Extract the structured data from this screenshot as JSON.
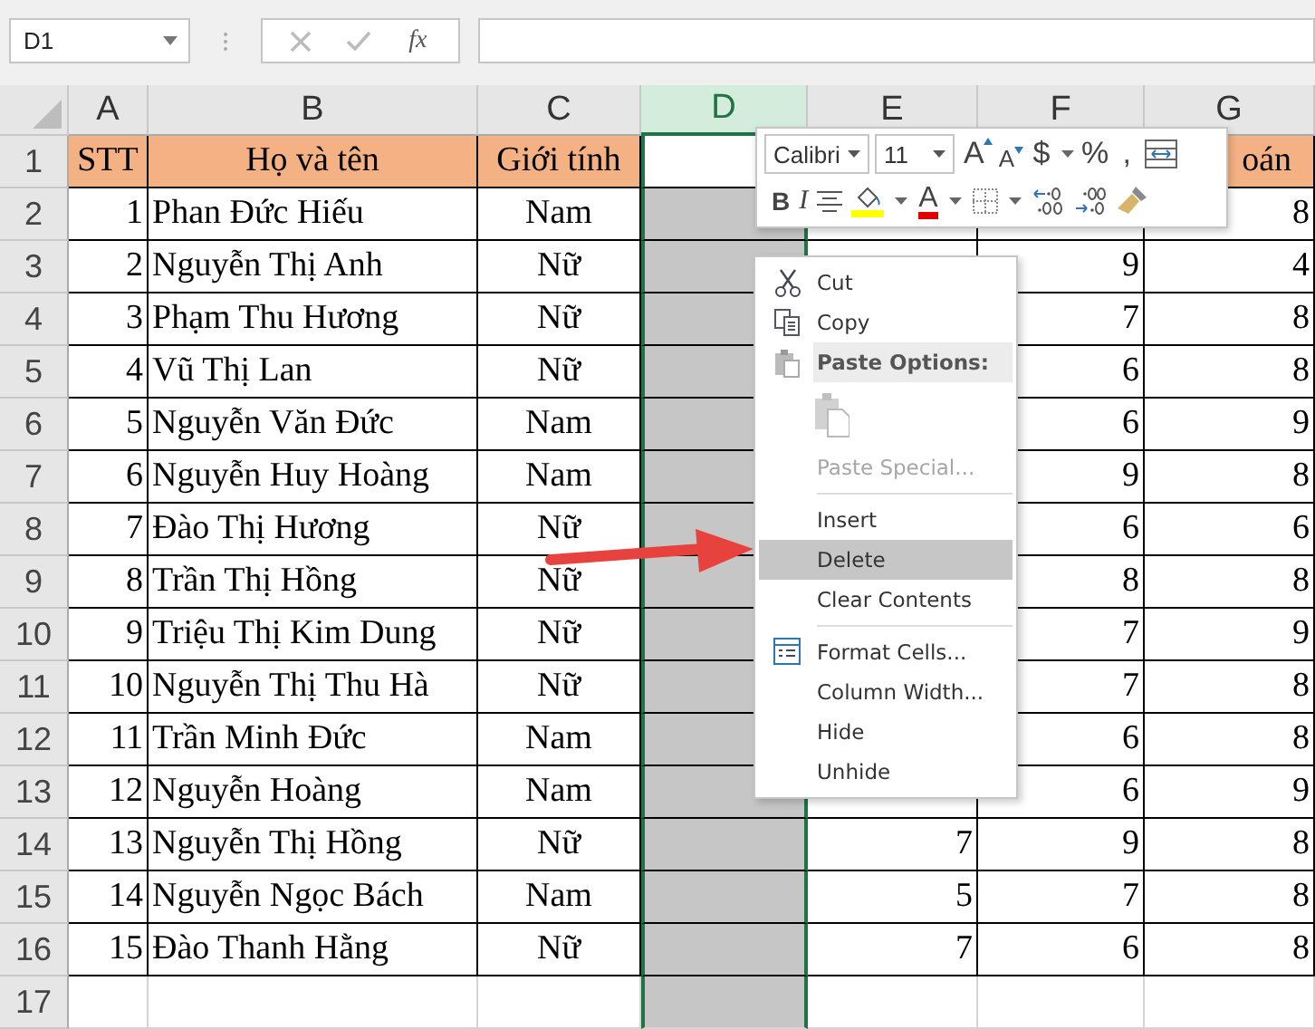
{
  "formula_bar": {
    "name_box": "D1",
    "function_label": "fx"
  },
  "columns": [
    {
      "label": "A",
      "selected": false
    },
    {
      "label": "B",
      "selected": false
    },
    {
      "label": "C",
      "selected": false
    },
    {
      "label": "D",
      "selected": true
    },
    {
      "label": "E",
      "selected": false
    },
    {
      "label": "F",
      "selected": false
    },
    {
      "label": "G",
      "selected": false
    }
  ],
  "rows": [
    {
      "number": "1",
      "kind": "header",
      "cells": [
        "STT",
        "Họ và tên",
        "Giới tính",
        "",
        null,
        null,
        "oán"
      ]
    },
    {
      "number": "2",
      "kind": "data",
      "cells": [
        "1",
        "Phan Đức Hiếu",
        "Nam",
        "",
        "",
        "",
        "8"
      ]
    },
    {
      "number": "3",
      "kind": "data",
      "cells": [
        "2",
        "Nguyễn Thị Anh",
        "Nữ",
        "",
        "",
        "9",
        "4"
      ]
    },
    {
      "number": "4",
      "kind": "data",
      "cells": [
        "3",
        "Phạm Thu Hương",
        "Nữ",
        "",
        null,
        "7",
        "8"
      ]
    },
    {
      "number": "5",
      "kind": "data",
      "cells": [
        "4",
        "Vũ Thị Lan",
        "Nữ",
        "",
        null,
        "6",
        "8"
      ]
    },
    {
      "number": "6",
      "kind": "data",
      "cells": [
        "5",
        "Nguyễn Văn Đức",
        "Nam",
        "",
        null,
        "6",
        "9"
      ]
    },
    {
      "number": "7",
      "kind": "data",
      "cells": [
        "6",
        "Nguyễn Huy Hoàng",
        "Nam",
        "",
        null,
        "9",
        "8"
      ]
    },
    {
      "number": "8",
      "kind": "data",
      "cells": [
        "7",
        "Đào Thị Hương",
        "Nữ",
        "",
        null,
        "6",
        "6"
      ]
    },
    {
      "number": "9",
      "kind": "data",
      "cells": [
        "8",
        "Trần Thị Hồng",
        "Nữ",
        "",
        null,
        "8",
        "8"
      ]
    },
    {
      "number": "10",
      "kind": "data",
      "cells": [
        "9",
        "Triệu Thị Kim Dung",
        "Nữ",
        "",
        null,
        "7",
        "9"
      ]
    },
    {
      "number": "11",
      "kind": "data",
      "cells": [
        "10",
        "Nguyễn Thị Thu Hà",
        "Nữ",
        "",
        null,
        "7",
        "8"
      ]
    },
    {
      "number": "12",
      "kind": "data",
      "cells": [
        "11",
        "Trần Minh Đức",
        "Nam",
        "",
        null,
        "6",
        "8"
      ]
    },
    {
      "number": "13",
      "kind": "data",
      "cells": [
        "12",
        "Nguyễn Hoàng",
        "Nam",
        "",
        "",
        "6",
        "9"
      ]
    },
    {
      "number": "14",
      "kind": "data",
      "cells": [
        "13",
        "Nguyễn Thị Hồng",
        "Nữ",
        "",
        "7",
        "9",
        "8"
      ]
    },
    {
      "number": "15",
      "kind": "data",
      "cells": [
        "14",
        "Nguyễn Ngọc Bách",
        "Nam",
        "",
        "5",
        "7",
        "8"
      ]
    },
    {
      "number": "16",
      "kind": "data",
      "cells": [
        "15",
        "Đào Thanh Hằng",
        "Nữ",
        "",
        "7",
        "6",
        "8"
      ]
    },
    {
      "number": "17",
      "kind": "empty",
      "cells": []
    }
  ],
  "mini_toolbar": {
    "font": "Calibri",
    "size": "11",
    "row_1": [
      {
        "kind": "grow",
        "label": "A"
      },
      {
        "kind": "shrink",
        "label": "A"
      },
      {
        "kind": "text",
        "label": "$"
      },
      {
        "kind": "caret"
      },
      {
        "kind": "text",
        "label": "%"
      },
      {
        "kind": "text",
        "label": ","
      },
      {
        "kind": "wrap"
      }
    ],
    "row_2": [
      {
        "kind": "bold",
        "label": "B"
      },
      {
        "kind": "italic",
        "label": "I"
      },
      {
        "kind": "align"
      },
      {
        "kind": "fill"
      },
      {
        "kind": "caret"
      },
      {
        "kind": "font-color",
        "label": "A"
      },
      {
        "kind": "caret"
      },
      {
        "kind": "borders"
      },
      {
        "kind": "caret"
      },
      {
        "kind": "inc-decimal"
      },
      {
        "kind": "dec-decimal"
      },
      {
        "kind": "painter"
      }
    ]
  },
  "context_menu": [
    {
      "kind": "cut",
      "label": "Cut",
      "disabled": false,
      "selected": false
    },
    {
      "kind": "copy",
      "label": "Copy",
      "disabled": false,
      "selected": false
    },
    {
      "kind": "header",
      "label": "Paste Options:"
    },
    {
      "kind": "paste-icon",
      "disabled": true
    },
    {
      "kind": "item",
      "label": "Paste Special...",
      "disabled": true,
      "selected": false
    },
    {
      "kind": "separator"
    },
    {
      "kind": "item",
      "label": "Insert",
      "disabled": false,
      "selected": false
    },
    {
      "kind": "item",
      "label": "Delete",
      "disabled": false,
      "selected": true
    },
    {
      "kind": "item",
      "label": "Clear Contents",
      "disabled": false,
      "selected": false
    },
    {
      "kind": "separator"
    },
    {
      "kind": "format",
      "label": "Format Cells...",
      "disabled": false,
      "selected": false
    },
    {
      "kind": "item",
      "label": "Column Width...",
      "disabled": false,
      "selected": false
    },
    {
      "kind": "item",
      "label": "Hide",
      "disabled": false,
      "selected": false
    },
    {
      "kind": "item",
      "label": "Unhide",
      "disabled": false,
      "selected": false
    }
  ]
}
